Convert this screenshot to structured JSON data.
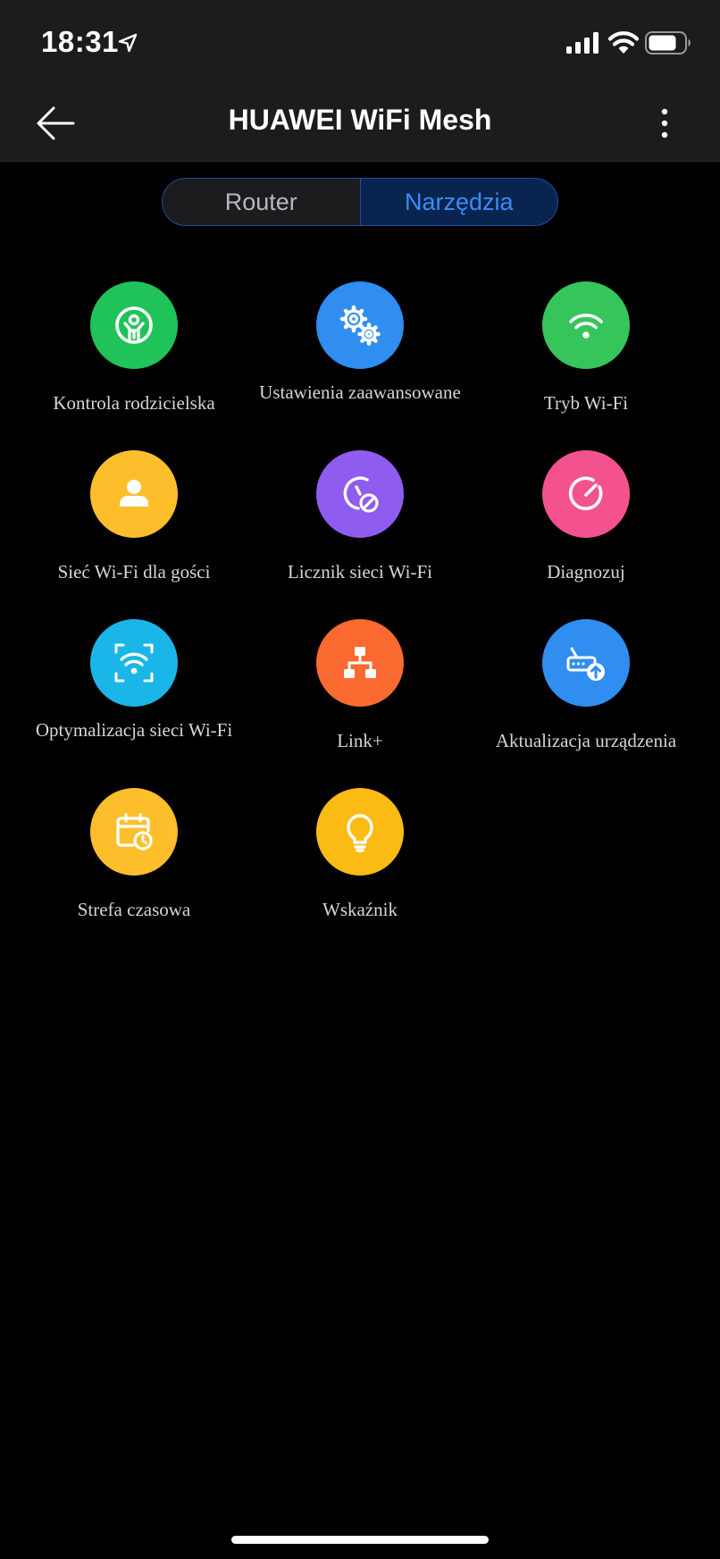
{
  "status_bar": {
    "time": "18:31"
  },
  "header": {
    "title": "HUAWEI WiFi Mesh"
  },
  "tabs": [
    {
      "label": "Router",
      "active": false
    },
    {
      "label": "Narzędzia",
      "active": true
    }
  ],
  "colors": {
    "accent": "#3b8cf5",
    "green": "#1fc35a",
    "blue": "#2f8ef0",
    "wifi_green": "#35c55a",
    "yellow": "#fcbf2b",
    "purple": "#8f5cf0",
    "pink": "#f4528f",
    "cyan": "#1ab6e8",
    "orange": "#fb6a30",
    "bulb_yellow": "#fbbb15"
  },
  "tools": [
    {
      "label": "Kontrola rodzicielska",
      "icon": "parental-control-icon"
    },
    {
      "label": "Ustawienia zaawansowane",
      "icon": "gears-icon"
    },
    {
      "label": "Tryb Wi-Fi",
      "icon": "wifi-icon"
    },
    {
      "label": "Sieć Wi-Fi dla gości",
      "icon": "guest-user-icon"
    },
    {
      "label": "Licznik sieci Wi-Fi",
      "icon": "wifi-timer-icon"
    },
    {
      "label": "Diagnozuj",
      "icon": "diagnose-gauge-icon"
    },
    {
      "label": "Optymalizacja sieci Wi-Fi",
      "icon": "wifi-optimize-icon"
    },
    {
      "label": "Link+",
      "icon": "network-topology-icon"
    },
    {
      "label": "Aktualizacja urządzenia",
      "icon": "router-upgrade-icon"
    },
    {
      "label": "Strefa czasowa",
      "icon": "calendar-clock-icon"
    },
    {
      "label": "Wskaźnik",
      "icon": "lightbulb-icon"
    }
  ]
}
